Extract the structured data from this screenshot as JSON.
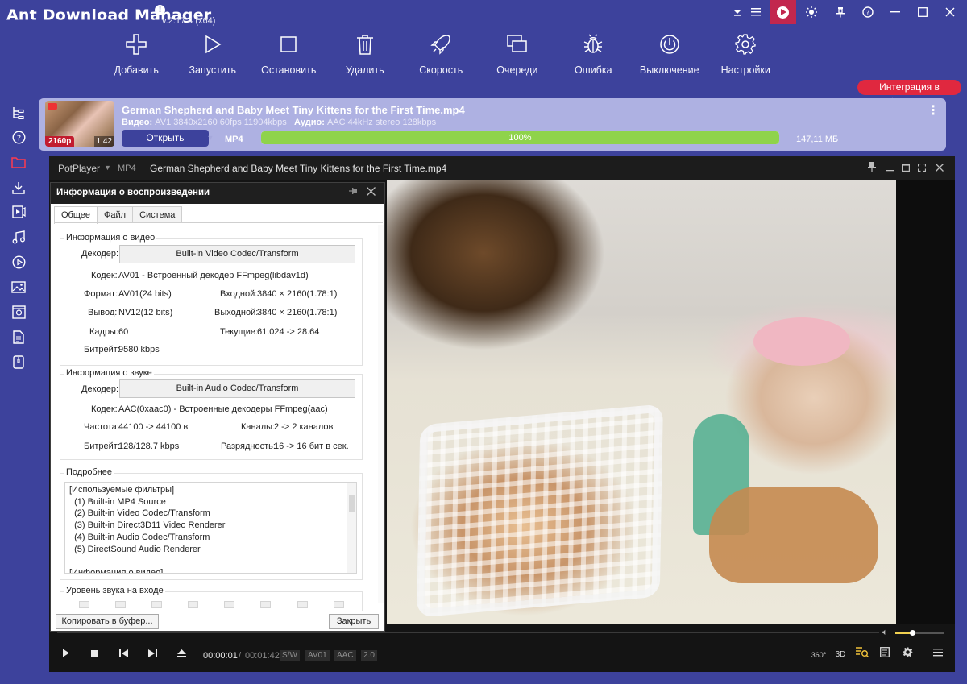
{
  "app": {
    "title": "Ant Download Manager",
    "version": "v.2.17.4 (x64)"
  },
  "toolbar": {
    "add": "Добавить",
    "start": "Запустить",
    "stop": "Остановить",
    "delete": "Удалить",
    "speed": "Скорость",
    "queues": "Очереди",
    "error": "Ошибка",
    "shutdown": "Выключение",
    "settings": "Настройки"
  },
  "integration_button": "Интеграция в браузеры",
  "download": {
    "filename": "German Shepherd and Baby Meet Tiny Kittens for the First Time.mp4",
    "video_label": "Видео:",
    "video_info": "AV1 3840x2160 60fps 11904kbps",
    "audio_label": "Аудио:",
    "audio_info": "AAC 44kHz stereo 128kbps",
    "resolution_badge": "2160p",
    "duration": "1:42",
    "open_button": "Открыть",
    "format": "MP4",
    "progress_text": "100%",
    "progress_value": 1.0,
    "size": "147,11 МБ"
  },
  "player": {
    "brand": "PotPlayer",
    "format": "MP4",
    "title": "German Shepherd and Baby Meet Tiny Kittens for the First Time.mp4",
    "time_current": "00:00:01",
    "time_separator": "/",
    "time_total": "00:01:42",
    "tag_sw": "S/W",
    "tag_av01": "AV01",
    "tag_aac": "AAC",
    "tag_ver": "2.0",
    "label_360": "360°",
    "label_3d": "3D",
    "volume_level": 0.35
  },
  "info_dialog": {
    "title": "Информация о воспроизведении",
    "tabs": [
      "Общее",
      "Файл",
      "Система"
    ],
    "video_group": "Информация о видео",
    "decoder_label": "Декодер:",
    "video_decoder_button": "Built-in Video Codec/Transform",
    "video_codec_label": "Кодек:",
    "video_codec_value": "AV01 - Встроенный декодер FFmpeg(libdav1d)",
    "format_label": "Формат:",
    "format_value": "AV01(24 bits)",
    "input_label": "Входной:",
    "input_value": "3840 × 2160(1.78:1)",
    "output_label": "Вывод:",
    "output_value": "NV12(12 bits)",
    "output_res_label": "Выходной:",
    "output_res_value": "3840 × 2160(1.78:1)",
    "frames_label": "Кадры:",
    "frames_value": "60",
    "current_label": "Текущие:",
    "current_value": "61.024 -> 28.64",
    "video_bitrate_label": "Битрейт:",
    "video_bitrate_value": "9580 kbps",
    "audio_group": "Информация о звуке",
    "audio_decoder_button": "Built-in Audio Codec/Transform",
    "audio_codec_value": "AAC(0xaac0) - Встроенные декодеры FFmpeg(aac)",
    "freq_label": "Частота:",
    "freq_value": "44100 -> 44100 в",
    "channels_label": "Каналы:",
    "channels_value": "2 -> 2 каналов",
    "audio_bitrate_label": "Битрейт:",
    "audio_bitrate_value": "128/128.7 kbps",
    "depth_label": "Разрядность:",
    "depth_value": "16 -> 16 бит в сек.",
    "details_group": "Подробнее",
    "details_lines": [
      "[Используемые фильтры]",
      "  (1) Built-in MP4 Source",
      "  (2) Built-in Video Codec/Transform",
      "  (3) Built-in Direct3D11 Video Renderer",
      "  (4) Built-in Audio Codec/Transform",
      "  (5) DirectSound Audio Renderer",
      "",
      "[Информация о видео]"
    ],
    "input_level_group": "Уровень звука на входе",
    "copy_button": "Копировать в буфер...",
    "close_button": "Закрыть"
  },
  "colors": {
    "app_bg": "#3d429c",
    "accent_red": "#c2274e",
    "progress_green": "#8fd34b",
    "row_bg": "#aeb1e2"
  }
}
